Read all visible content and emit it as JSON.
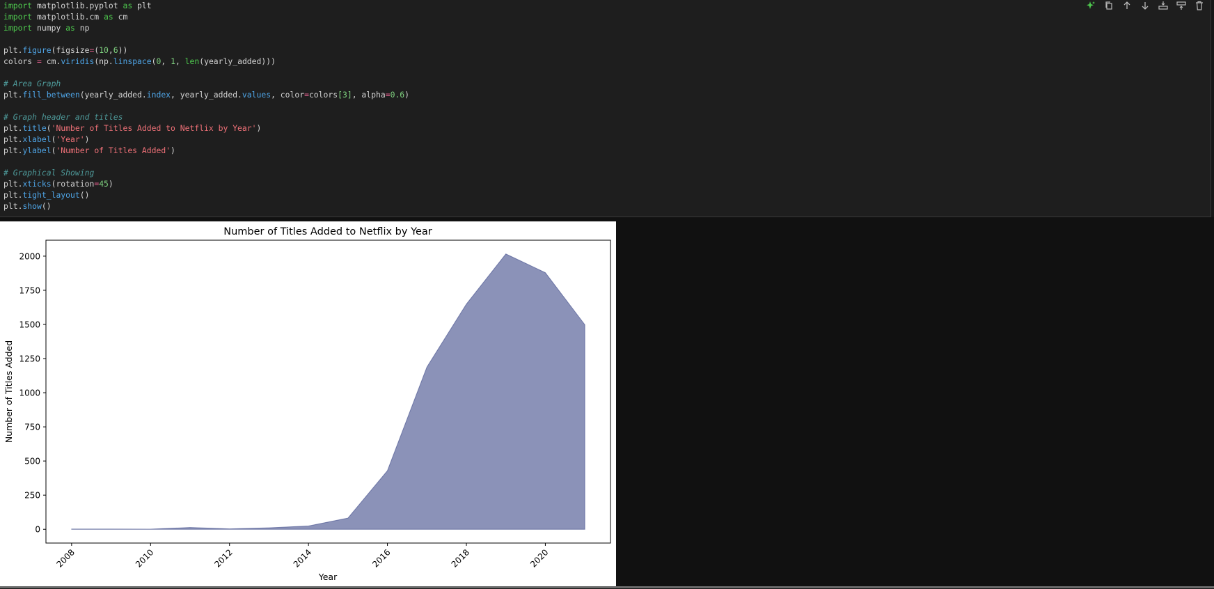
{
  "toolbar": {
    "icons": [
      "sparkle-icon",
      "copy-icon",
      "arrow-up-icon",
      "arrow-down-icon",
      "insert-below-icon",
      "insert-above-icon",
      "trash-icon"
    ],
    "accent": "#4ec94e"
  },
  "code": {
    "line_1": {
      "kw1": "import",
      "rest1": " matplotlib.pyplot ",
      "kw2": "as",
      "rest2": " plt"
    },
    "line_2": {
      "kw1": "import",
      "rest1": " matplotlib.cm ",
      "kw2": "as",
      "rest2": " cm"
    },
    "line_3": {
      "kw1": "import",
      "rest1": " numpy ",
      "kw2": "as",
      "rest2": " np"
    },
    "line_5": {
      "a": "plt.",
      "fn": "figure",
      "b": "(figsize",
      "op": "=",
      "c": "(",
      "n1": "10",
      "d": ",",
      "n2": "6",
      "e": "))"
    },
    "line_6": {
      "a": "colors ",
      "op": "=",
      "b": " cm.",
      "fn1": "viridis",
      "c": "(np.",
      "fn2": "linspace",
      "d": "(",
      "n1": "0",
      "e": ", ",
      "n2": "1",
      "f": ", ",
      "fn3": "len",
      "g": "(yearly_added)))"
    },
    "line_8": "# Area Graph",
    "line_9": {
      "a": "plt.",
      "fn1": "fill_between",
      "b": "(yearly_added.",
      "fn2": "index",
      "c": ", yearly_added.",
      "fn3": "values",
      "d": ", color",
      "op1": "=",
      "e": "colors",
      "n1": "[3]",
      "f": ", alpha",
      "op2": "=",
      "n2": "0.6",
      "g": ")"
    },
    "line_11": "# Graph header and titles",
    "line_12": {
      "a": "plt.",
      "fn": "title",
      "b": "(",
      "str": "'Number of Titles Added to Netflix by Year'",
      "c": ")"
    },
    "line_13": {
      "a": "plt.",
      "fn": "xlabel",
      "b": "(",
      "str": "'Year'",
      "c": ")"
    },
    "line_14": {
      "a": "plt.",
      "fn": "ylabel",
      "b": "(",
      "str": "'Number of Titles Added'",
      "c": ")"
    },
    "line_16": "# Graphical Showing",
    "line_17": {
      "a": "plt.",
      "fn": "xticks",
      "b": "(rotation",
      "op": "=",
      "n": "45",
      "c": ")"
    },
    "line_18": {
      "a": "plt.",
      "fn": "tight_layout",
      "b": "()"
    },
    "line_19": {
      "a": "plt.",
      "fn": "show",
      "b": "()"
    }
  },
  "chart_data": {
    "type": "area",
    "title": "Number of Titles Added to Netflix by Year",
    "xlabel": "Year",
    "ylabel": "Number of Titles Added",
    "x": [
      2008,
      2009,
      2010,
      2011,
      2012,
      2013,
      2014,
      2015,
      2016,
      2017,
      2018,
      2019,
      2020,
      2021
    ],
    "values": [
      2,
      2,
      1,
      13,
      3,
      11,
      24,
      82,
      429,
      1188,
      1649,
      2016,
      1879,
      1498
    ],
    "xticks": [
      "2008",
      "2010",
      "2012",
      "2014",
      "2016",
      "2018",
      "2020"
    ],
    "yticks": [
      "0",
      "250",
      "500",
      "750",
      "1000",
      "1250",
      "1500",
      "1750",
      "2000"
    ],
    "xlim": [
      2007.35,
      2021.65
    ],
    "ylim": [
      -100.8,
      2116.8
    ],
    "fill_color": "#3e4a89",
    "alpha": 0.6,
    "grid": false,
    "xtick_rotation": 45
  }
}
